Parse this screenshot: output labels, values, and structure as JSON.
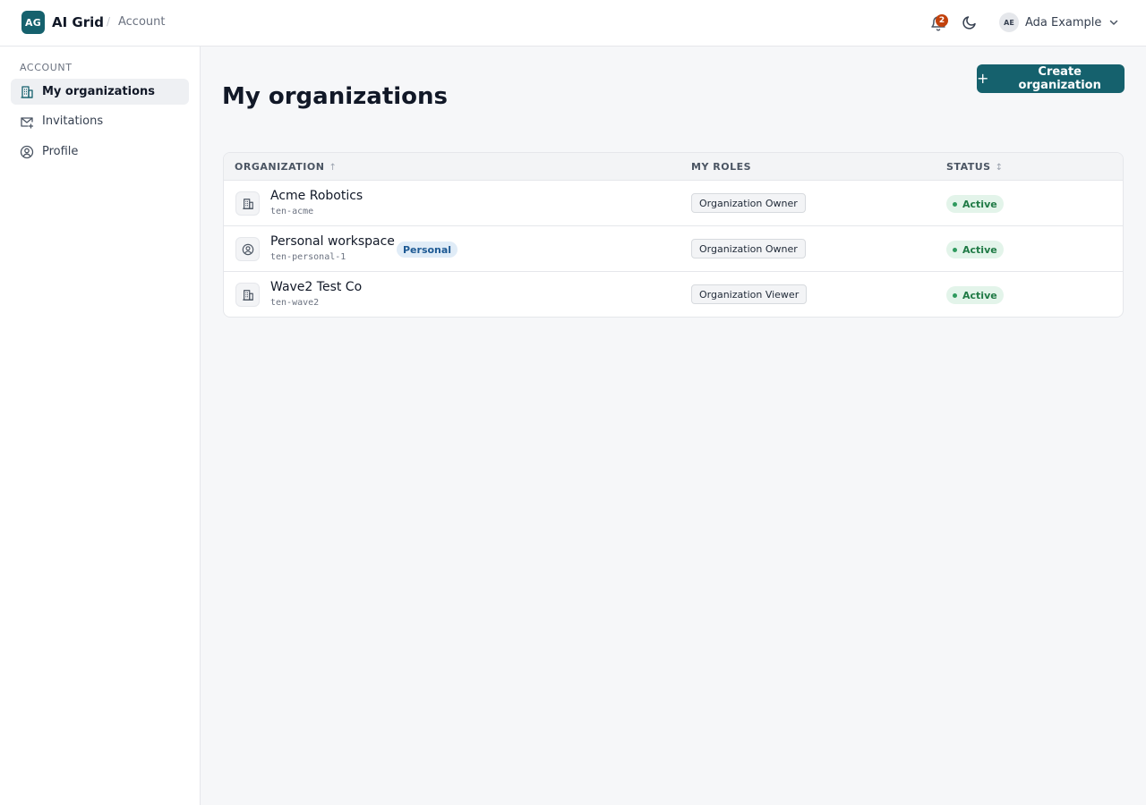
{
  "header": {
    "logo_text": "AG",
    "app_name": "AI Grid",
    "breadcrumb_sep": "/",
    "breadcrumb": "Account",
    "notification_count": "2",
    "user_initials": "AE",
    "user_name": "Ada Example",
    "icons": [
      "bell-icon",
      "moon-icon",
      "chevron-down-icon"
    ]
  },
  "sidebar": {
    "heading": "ACCOUNT",
    "items": [
      {
        "label": "My organizations",
        "icon": "building-icon",
        "active": true
      },
      {
        "label": "Invitations",
        "icon": "mail-plus-icon",
        "active": false
      },
      {
        "label": "Profile",
        "icon": "user-circle-icon",
        "active": false
      }
    ]
  },
  "main": {
    "title": "My organizations",
    "create_button": {
      "icon": "+",
      "label": "Create organization"
    }
  },
  "table": {
    "columns": [
      {
        "label": "ORGANIZATION",
        "sort": "↑"
      },
      {
        "label": "MY ROLES",
        "sort": ""
      },
      {
        "label": "STATUS",
        "sort": "↕"
      }
    ],
    "rows": [
      {
        "name": "Acme Robotics",
        "slug": "ten-acme",
        "icon": "building-icon",
        "badge": "",
        "role": "Organization Owner",
        "status": "Active"
      },
      {
        "name": "Personal workspace",
        "slug": "ten-personal-1",
        "icon": "user-circle-icon",
        "badge": "Personal",
        "role": "Organization Owner",
        "status": "Active"
      },
      {
        "name": "Wave2 Test Co",
        "slug": "ten-wave2",
        "icon": "building-icon",
        "badge": "",
        "role": "Organization Viewer",
        "status": "Active"
      }
    ]
  },
  "colors": {
    "brand": "#15616d",
    "notification": "#c2410c",
    "status_active_bg": "#e3f4ea",
    "status_active_text": "#1f7a45",
    "personal_badge_bg": "#e0ecf7"
  }
}
